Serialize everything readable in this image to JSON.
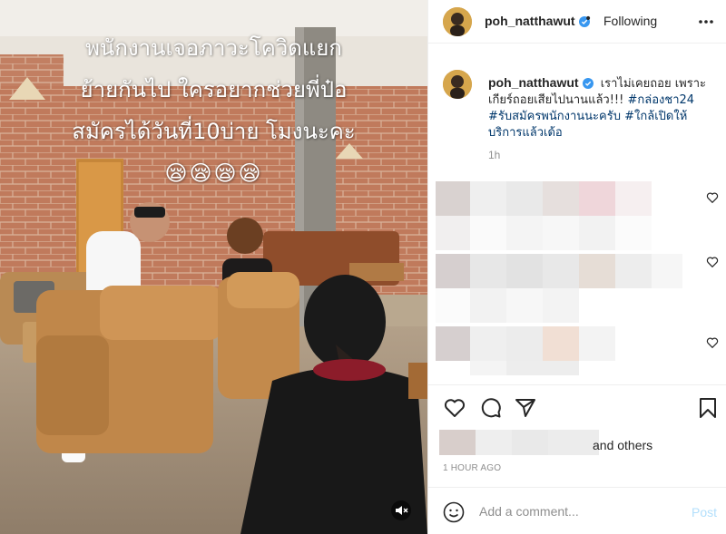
{
  "media": {
    "overlay_lines": [
      "พนักงานเจอภาวะโควิดแยก",
      "ย้ายกันไป ใครอยากช่วยพี่ป๋อ",
      "สมัครได้วันที่10บ่าย โมงนะคะ"
    ],
    "overlay_emoji": "😪😪😪😪",
    "mute_icon": "speaker-muted-icon"
  },
  "header": {
    "username": "poh_natthawut",
    "separator": "•",
    "follow_state": "Following",
    "more_icon": "more-horizontal-icon"
  },
  "caption": {
    "username": "poh_natthawut",
    "text_plain": "เราไม่เคยถอย เพราะเกียร์ถอยเสียไปนานแล้ว!!! ",
    "hashtag_1": "#กล่องชา24",
    "text_between": " ",
    "hashtag_2": "#รับสมัครพนักงานนะครับ",
    "text_between_2": " ",
    "hashtag_3": "#ใกล้เปิดให้บริการแล้วเด้อ",
    "time": "1h"
  },
  "actions": {
    "like_icon": "heart-icon",
    "comment_icon": "comment-icon",
    "share_icon": "share-paper-plane-icon",
    "save_icon": "bookmark-icon"
  },
  "likes": {
    "suffix": "and others"
  },
  "timestamp": "1 HOUR AGO",
  "comment_box": {
    "placeholder": "Add a comment...",
    "post_label": "Post",
    "emoji_icon": "smiley-icon"
  },
  "colors": {
    "link": "#00376b",
    "verified": "#3897f0",
    "post_disabled": "#b2dffc",
    "muted": "#8e8e8e"
  }
}
